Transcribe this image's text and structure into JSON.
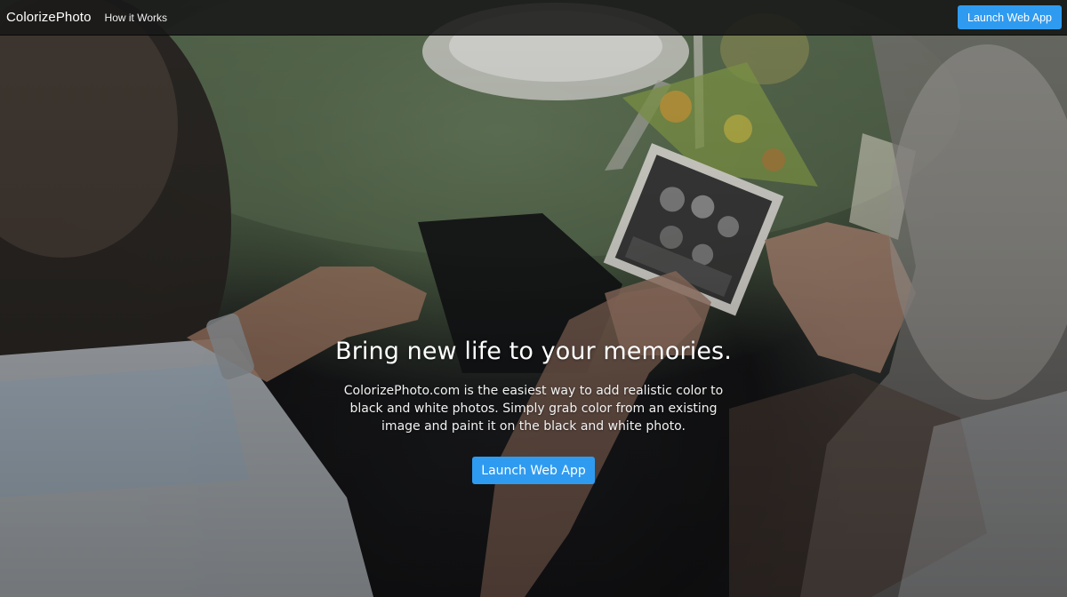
{
  "navbar": {
    "brand": "ColorizePhoto",
    "links": [
      {
        "label": "How it Works"
      }
    ],
    "launch_label": "Launch Web App"
  },
  "hero": {
    "headline": "Bring new life to your memories.",
    "description": "ColorizePhoto.com is the easiest way to add realistic color to black and white photos. Simply grab color from an existing image and paint it on the black and white photo.",
    "cta_label": "Launch Web App"
  },
  "colors": {
    "accent": "#2f9bf0",
    "navbar_bg": "#181818",
    "text": "#ffffff"
  }
}
